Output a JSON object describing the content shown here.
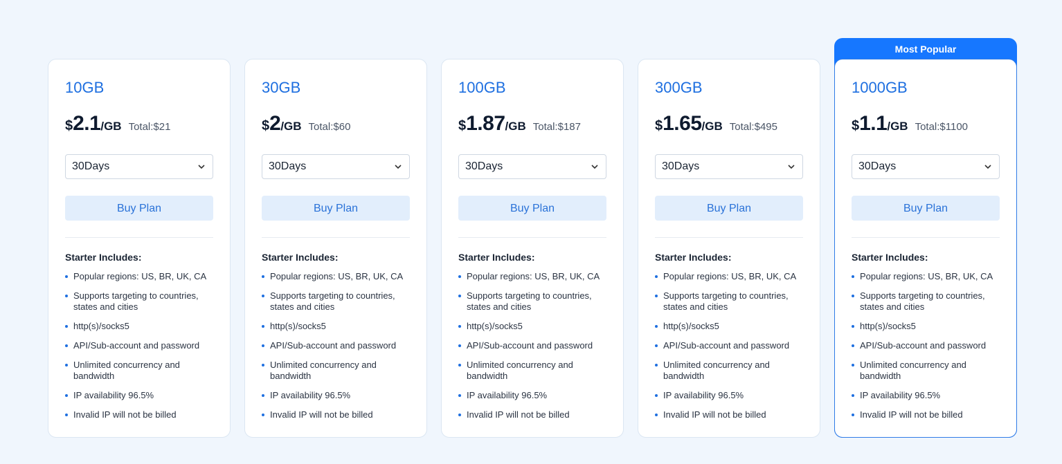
{
  "currency_symbol": "$",
  "accent_color": "#1677ff",
  "plans": [
    {
      "name": "10GB",
      "price": "2.1",
      "unit": "/GB",
      "total": "Total:$21",
      "duration": "30Days",
      "buy_label": "Buy Plan",
      "includes_title": "Starter Includes:",
      "popular": false
    },
    {
      "name": "30GB",
      "price": "2",
      "unit": "/GB",
      "total": "Total:$60",
      "duration": "30Days",
      "buy_label": "Buy Plan",
      "includes_title": "Starter Includes:",
      "popular": false
    },
    {
      "name": "100GB",
      "price": "1.87",
      "unit": "/GB",
      "total": "Total:$187",
      "duration": "30Days",
      "buy_label": "Buy Plan",
      "includes_title": "Starter Includes:",
      "popular": false
    },
    {
      "name": "300GB",
      "price": "1.65",
      "unit": "/GB",
      "total": "Total:$495",
      "duration": "30Days",
      "buy_label": "Buy Plan",
      "includes_title": "Starter Includes:",
      "popular": false
    },
    {
      "name": "1000GB",
      "price": "1.1",
      "unit": "/GB",
      "total": "Total:$1100",
      "duration": "30Days",
      "buy_label": "Buy Plan",
      "includes_title": "Starter Includes:",
      "popular": true,
      "badge": "Most Popular"
    }
  ],
  "features": [
    "Popular regions: US, BR, UK, CA",
    "Supports targeting to countries, states and cities",
    "http(s)/socks5",
    "API/Sub-account and password",
    "Unlimited concurrency and bandwidth",
    "IP availability 96.5%",
    "Invalid IP will not be billed"
  ]
}
